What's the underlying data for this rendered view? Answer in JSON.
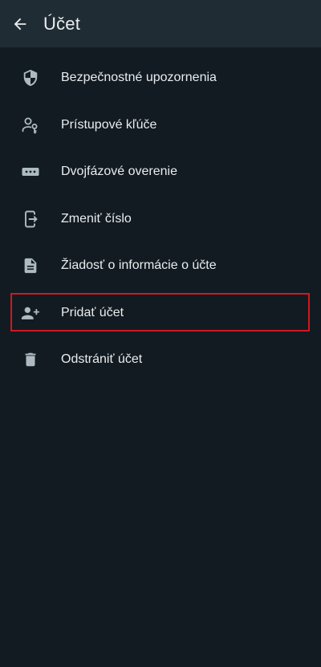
{
  "header": {
    "title": "Účet",
    "back_icon": "arrow-left-icon"
  },
  "menu": {
    "items": [
      {
        "label": "Bezpečnostné upozornenia",
        "icon": "shield-icon"
      },
      {
        "label": "Prístupové kľúče",
        "icon": "person-key-icon"
      },
      {
        "label": "Dvojfázové overenie",
        "icon": "password-dots-icon"
      },
      {
        "label": "Zmeniť číslo",
        "icon": "phone-transfer-icon"
      },
      {
        "label": "Žiadosť o informácie o účte",
        "icon": "document-icon"
      },
      {
        "label": "Pridať účet",
        "icon": "add-person-icon"
      },
      {
        "label": "Odstrániť účet",
        "icon": "trash-icon"
      }
    ]
  },
  "colors": {
    "background": "#121b22",
    "app_bar": "#1f2c34",
    "text_primary": "#e9edef",
    "icon": "#aebac1",
    "highlight_border": "#d3171f"
  }
}
